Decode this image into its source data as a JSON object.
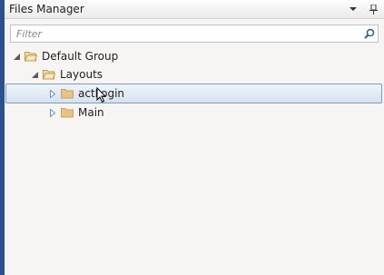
{
  "panel": {
    "title": "Files Manager",
    "pin_icon": "pin-icon",
    "dropdown_icon": "chevron-down-icon"
  },
  "filter": {
    "placeholder": "Filter",
    "value": "",
    "icon": "search-icon"
  },
  "tree": {
    "root": {
      "label": "Default Group",
      "expanded": true
    },
    "layouts": {
      "label": "Layouts",
      "expanded": true
    },
    "items": [
      {
        "label": "actLogin",
        "expanded": false,
        "selected": true
      },
      {
        "label": "Main",
        "expanded": false,
        "selected": false
      }
    ]
  },
  "colors": {
    "accent_rail": "#2b4f8f",
    "selection_border": "#7f9db9",
    "folder_fill": "#e6c388"
  }
}
